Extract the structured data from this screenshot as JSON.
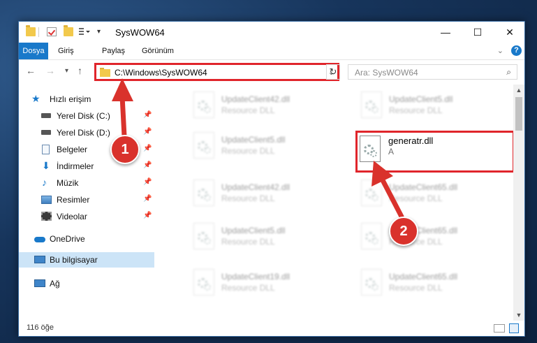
{
  "window": {
    "title": "SysWOW64",
    "controls": {
      "minimize": "—",
      "maximize": "☐",
      "close": "✕"
    }
  },
  "ribbon": {
    "tabs": [
      "Dosya",
      "Giriş",
      "Paylaş",
      "Görünüm"
    ],
    "help": "?"
  },
  "navigation": {
    "address": "C:\\Windows\\SysWOW64",
    "search_placeholder": "Ara: SysWOW64"
  },
  "sidebar": {
    "items": [
      {
        "label": "Hızlı erişim",
        "icon": "star-icon"
      },
      {
        "label": "Yerel Disk (C:)",
        "icon": "drive-icon",
        "pinned": true
      },
      {
        "label": "Yerel Disk (D:)",
        "icon": "drive-icon",
        "pinned": true
      },
      {
        "label": "Belgeler",
        "icon": "documents-icon",
        "pinned": true
      },
      {
        "label": "İndirmeler",
        "icon": "download-icon",
        "pinned": true
      },
      {
        "label": "Müzik",
        "icon": "music-icon",
        "pinned": true
      },
      {
        "label": "Resimler",
        "icon": "pictures-icon",
        "pinned": true
      },
      {
        "label": "Videolar",
        "icon": "videos-icon",
        "pinned": true
      },
      {
        "label": "OneDrive",
        "icon": "cloud-icon"
      },
      {
        "label": "Bu bilgisayar",
        "icon": "computer-icon",
        "selected": true
      },
      {
        "label": "Ağ",
        "icon": "network-icon"
      }
    ]
  },
  "files": [
    {
      "name": "UpdateClient42.dll",
      "desc": "Resource DLL"
    },
    {
      "name": "UpdateClient5.dll",
      "desc": "Resource DLL"
    },
    {
      "name": "UpdateClient5.dll",
      "desc": "Resource DLL"
    },
    {
      "name": "generatr.dll",
      "desc": "A",
      "highlighted": true
    },
    {
      "name": "UpdateClient42.dll",
      "desc": "Resource DLL"
    },
    {
      "name": "UpdateClient65.dll",
      "desc": "Resource DLL"
    },
    {
      "name": "UpdateClient5.dll",
      "desc": "Resource DLL"
    },
    {
      "name": "UpdateClient65.dll",
      "desc": "Resource DLL"
    },
    {
      "name": "UpdateClient19.dll",
      "desc": "Resource DLL"
    },
    {
      "name": "UpdateClient65.dll",
      "desc": "Resource DLL"
    }
  ],
  "status": {
    "item_count": "116 öğe"
  },
  "annotations": {
    "step1": "1",
    "step2": "2"
  },
  "colors": {
    "accent": "#1979ca",
    "annotation_red": "#e0252b"
  }
}
